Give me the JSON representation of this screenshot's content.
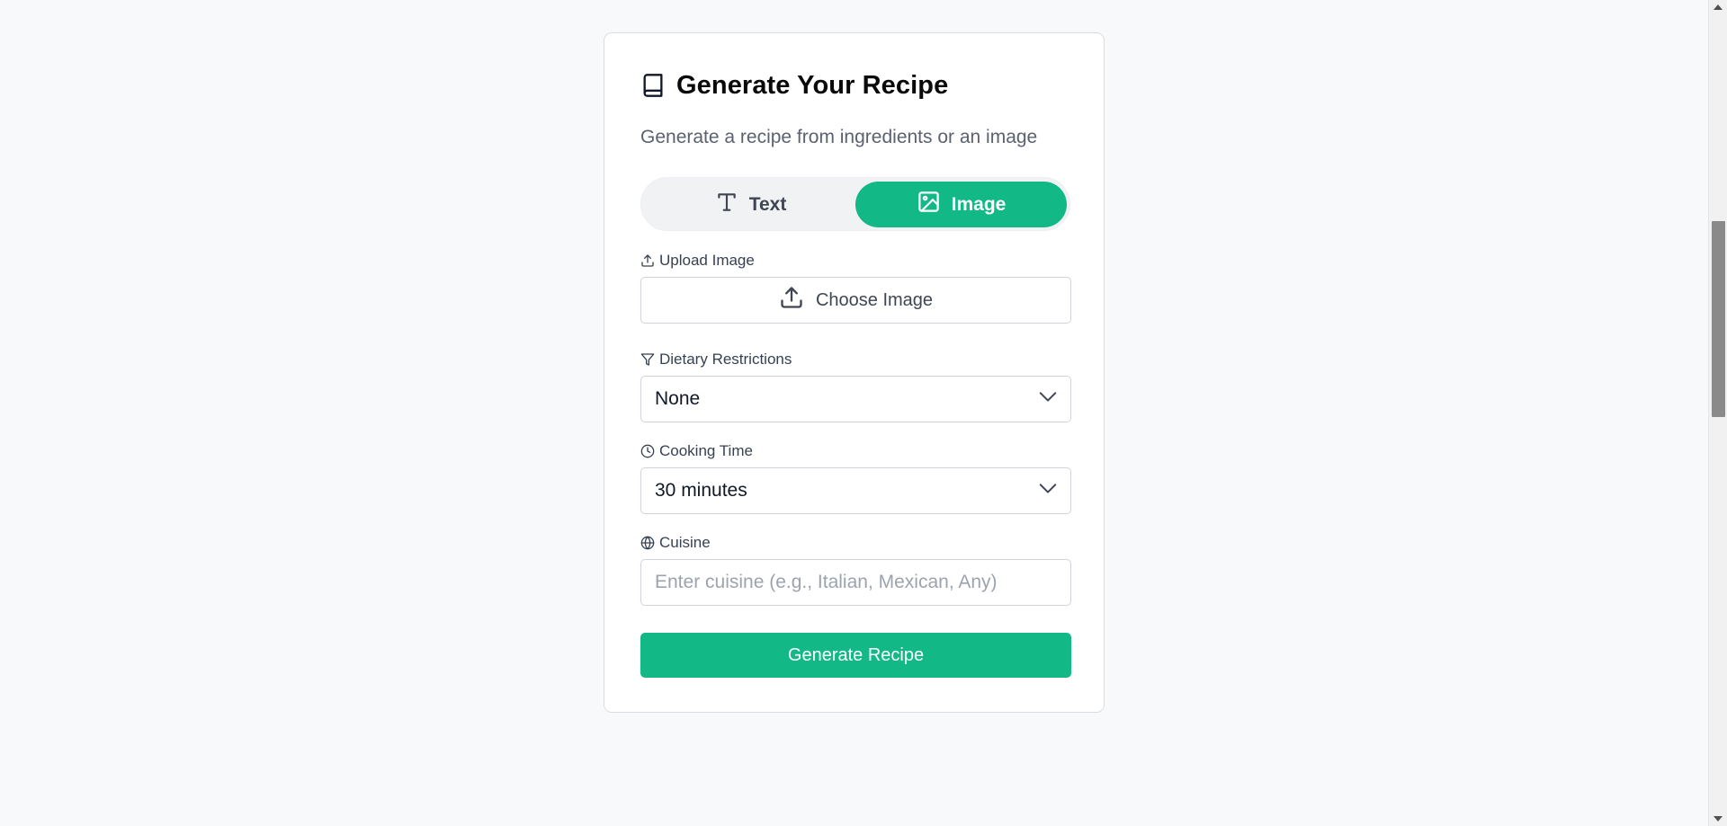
{
  "card": {
    "title": "Generate Your Recipe",
    "title_icon": "book-icon",
    "subtitle": "Generate a recipe from ingredients or an image"
  },
  "mode_toggle": {
    "selected": "Image",
    "text_label": "Text",
    "text_icon": "type-icon",
    "image_label": "Image",
    "image_icon": "image-icon"
  },
  "upload": {
    "label": "Upload Image",
    "label_icon": "upload-icon",
    "button_label": "Choose Image",
    "button_icon": "upload-icon"
  },
  "dietary": {
    "label": "Dietary Restrictions",
    "label_icon": "filter-icon",
    "value": "None"
  },
  "cooking_time": {
    "label": "Cooking Time",
    "label_icon": "clock-icon",
    "value": "30 minutes"
  },
  "cuisine": {
    "label": "Cuisine",
    "label_icon": "globe-icon",
    "value": "",
    "placeholder": "Enter cuisine (e.g., Italian, Mexican, Any)"
  },
  "actions": {
    "generate_label": "Generate Recipe"
  },
  "colors": {
    "accent": "#12b886",
    "page_background": "#f8f9fa",
    "card_background": "#ffffff"
  }
}
